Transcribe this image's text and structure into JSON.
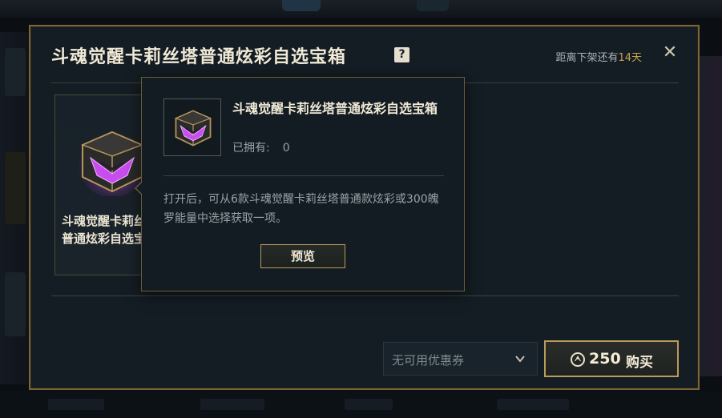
{
  "modal": {
    "title": "斗魂觉醒卡莉丝塔普通炫彩自选宝箱",
    "help_icon": "?",
    "timer_prefix": "距离下架还有",
    "timer_days": "14天",
    "close_icon": "✕"
  },
  "card": {
    "name": "斗魂觉醒卡莉丝塔普通炫彩自选宝箱"
  },
  "tooltip": {
    "name": "斗魂觉醒卡莉丝塔普通炫彩自选宝箱",
    "owned_label": "已拥有:",
    "owned_count": "0",
    "description": "打开后，可从6款斗魂觉醒卡莉丝塔普通款炫彩或300魄罗能量中选择获取一项。",
    "preview_label": "预览"
  },
  "footer": {
    "coupon_placeholder": "无可用优惠券",
    "price": "250",
    "buy_label": "购买"
  },
  "colors": {
    "gold_border": "#b99b5a",
    "accent_days": "#c9a34e",
    "modal_bg": "#141d24",
    "chest_purple": "#c94cf0"
  }
}
